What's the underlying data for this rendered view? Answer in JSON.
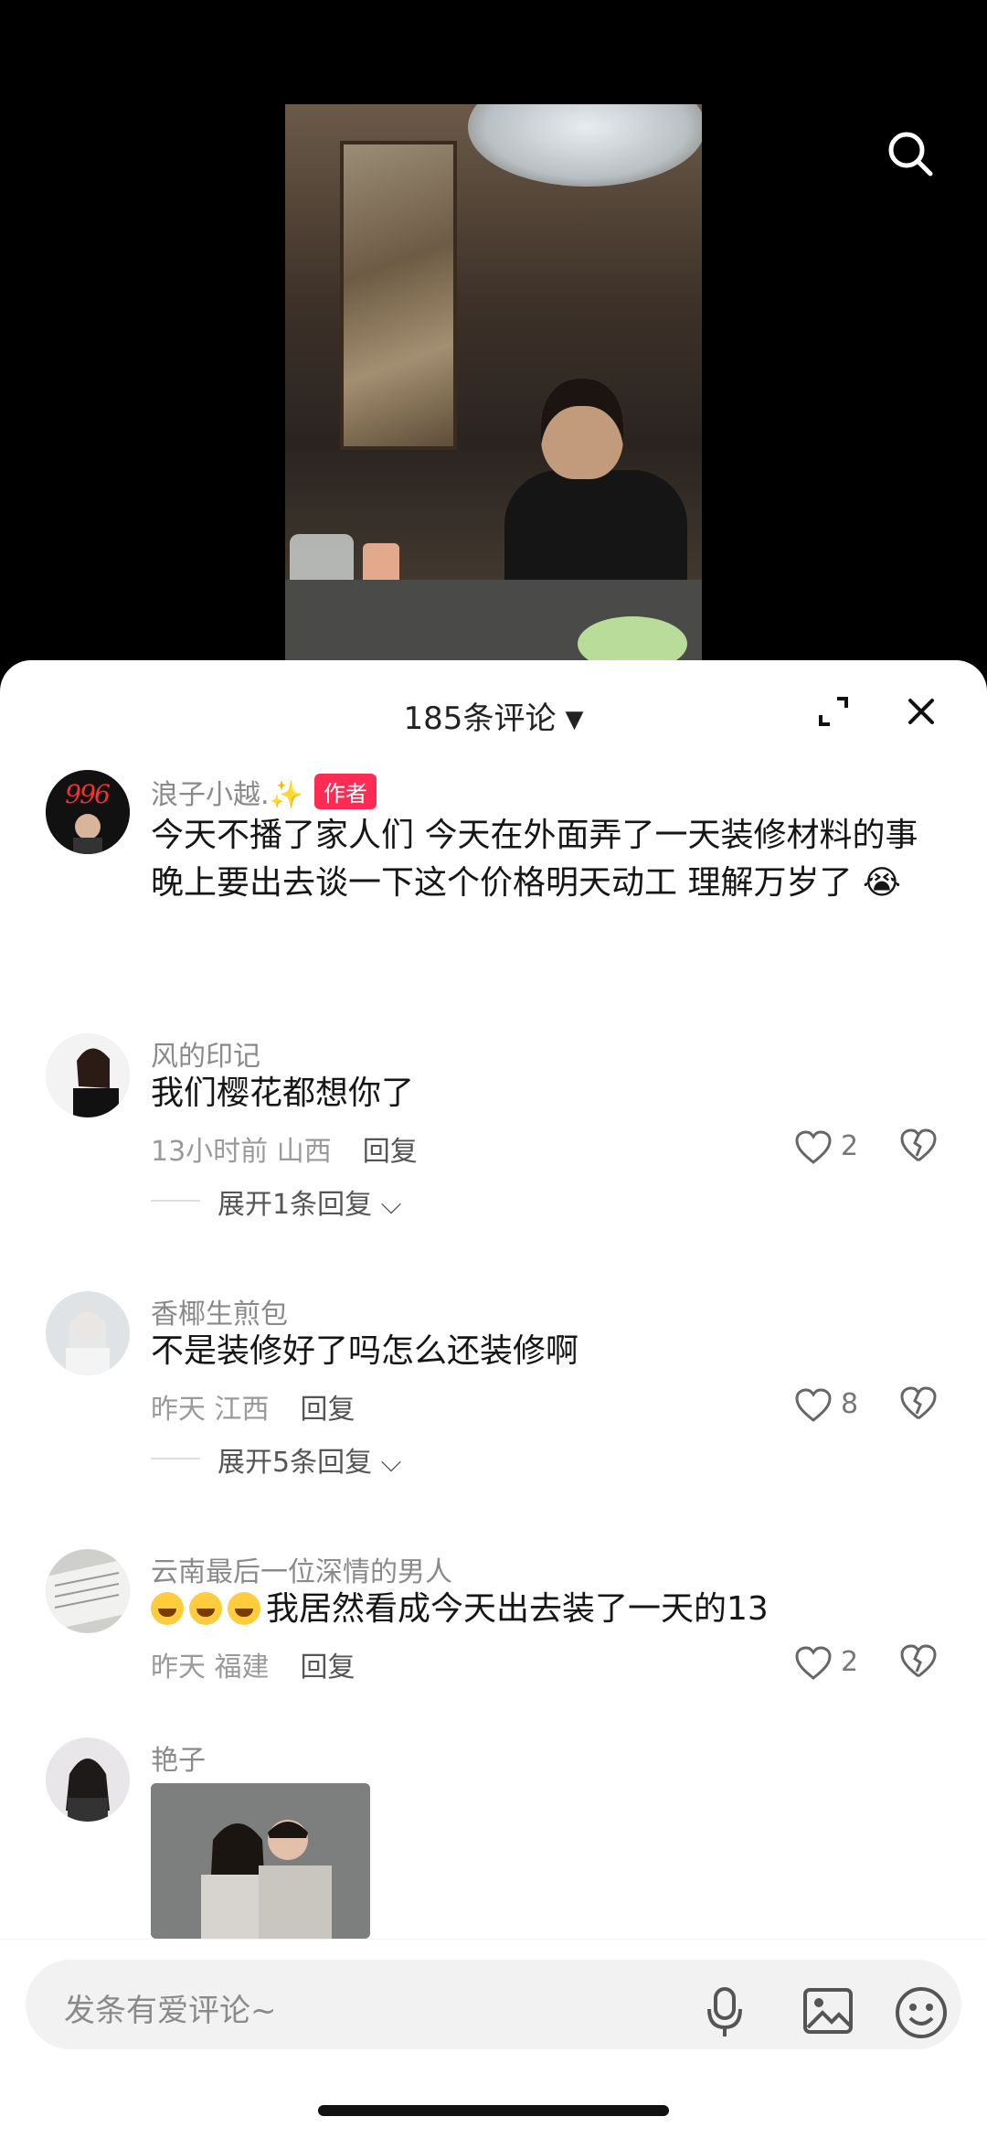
{
  "video": {
    "description_icon": "search-icon"
  },
  "comments_panel": {
    "count_label": "185条评论",
    "caret": "▼"
  },
  "comments": [
    {
      "username": "浪子小越.",
      "badge": "作者",
      "text": "今天不播了家人们 今天在外面弄了一天装修材料的事 晚上要出去谈一下这个价格明天动工 理解万岁了"
    },
    {
      "username": "风的印记",
      "text": "我们樱花都想你了",
      "time": "13小时前",
      "location": "山西",
      "reply_label": "回复",
      "likes": "2",
      "expand_label": "展开1条回复"
    },
    {
      "username": "香椰生煎包",
      "text": "不是装修好了吗怎么还装修啊",
      "time": "昨天",
      "location": "江西",
      "reply_label": "回复",
      "likes": "8",
      "expand_label": "展开5条回复"
    },
    {
      "username": "云南最后一位深情的男人",
      "text": "我居然看成今天出去装了一天的13",
      "time": "昨天",
      "location": "福建",
      "reply_label": "回复",
      "likes": "2"
    },
    {
      "username": "艳子"
    }
  ],
  "input": {
    "placeholder": "发条有爱评论~"
  },
  "colors": {
    "badge": "#fe2c55",
    "sheet": "#ffffff",
    "background": "#000000"
  }
}
